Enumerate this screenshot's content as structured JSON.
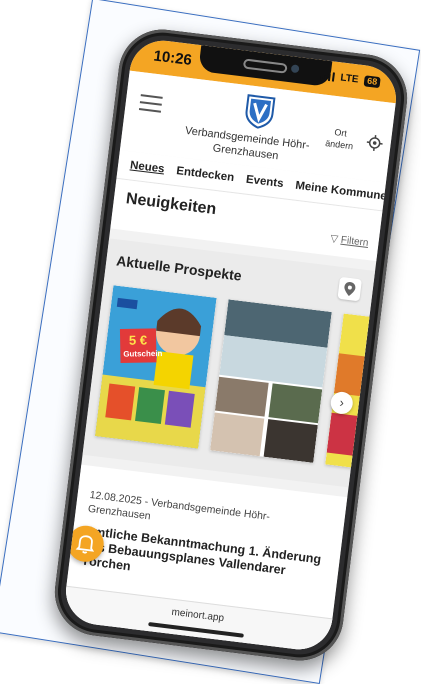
{
  "status": {
    "time": "10:26",
    "network": "LTE",
    "battery": "68"
  },
  "header": {
    "org_name": "Verbandsgemeinde Höhr-Grenzhausen",
    "location_label": "Ort ändern",
    "logo_icon": "coat-of-arms-icon",
    "menu_icon": "hamburger-icon",
    "location_icon": "crosshair-icon"
  },
  "tabs": [
    {
      "label": "Neues",
      "active": true
    },
    {
      "label": "Entdecken"
    },
    {
      "label": "Events"
    },
    {
      "label": "Meine Kommune"
    }
  ],
  "page": {
    "title": "Neuigkeiten",
    "filter_label": "Filtern"
  },
  "prospekte": {
    "title": "Aktuelle Prospekte",
    "flyer1_badge": "5 €",
    "flyer1_text": "Gutschein"
  },
  "news": {
    "meta": "12.08.2025 - Verbandsgemeinde Höhr-Grenzhausen",
    "title": "Amtliche Bekanntmachung 1. Änderung des Bebauungsplanes Vallendarer Törchen"
  },
  "footer": {
    "url": "meinort.app"
  },
  "colors": {
    "accent": "#f4a523",
    "frame": "#3a6ec0"
  }
}
